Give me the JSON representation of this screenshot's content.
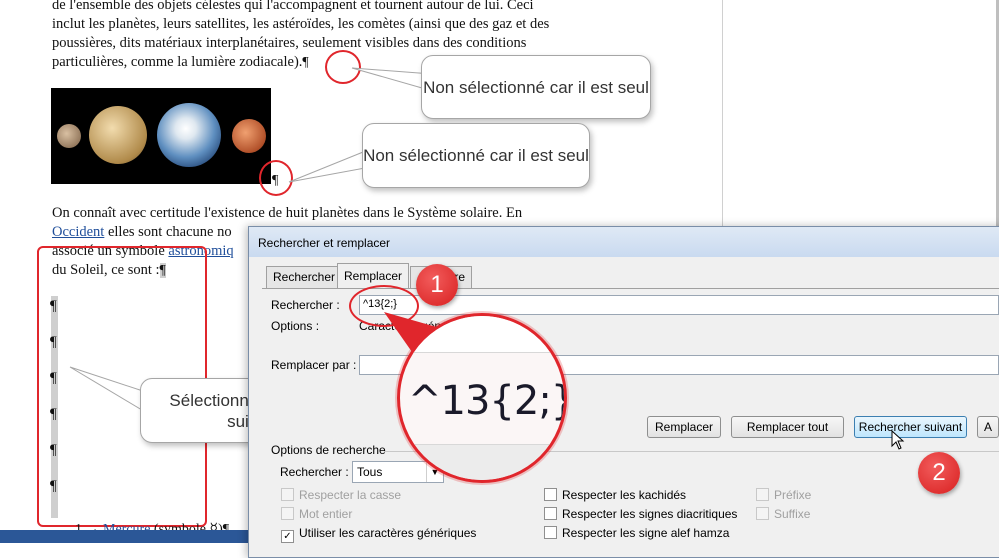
{
  "document": {
    "para1_line1": "de l'ensemble des objets célestes qui l'accompagnent et tournent autour de lui. Ceci",
    "para1_line2": "inclut les planètes, leurs satellites, les astéroïdes, les comètes (ainsi que des gaz et des",
    "para1_line3": "poussières, dits matériaux interplanétaires, seulement visibles dans des conditions",
    "para1_line4": "particulières, comme la lumière zodiacale).",
    "para1_end_pilcrow": "¶",
    "image_pilcrow": "¶",
    "para2_line1": "On connaît avec certitude l'existence de huit planètes dans le Système solaire. En",
    "para2_link1": "Occident",
    "para2_line2_rest": " elles sont chacune no",
    "para2_line3_start": "associé un symbole ",
    "para2_link2": "astronomiq",
    "para2_line4": "du Soleil, ce sont :",
    "para2_end_pilcrow": "¶",
    "pilcrows": [
      "¶",
      "¶",
      "¶",
      "¶",
      "¶",
      "¶"
    ],
    "bottom_item_number": "1 →",
    "bottom_item_link": "Mercure",
    "bottom_item_rest": " (symbole ☿)¶"
  },
  "callouts": {
    "c1": "Non sélectionné car il est seul",
    "c2": "Non sélectionné car il est seul",
    "c3": "Sélectionnés car ils se suivent"
  },
  "dialog": {
    "title": "Rechercher et remplacer",
    "tabs": [
      "Rechercher",
      "Remplacer",
      "Atteindre"
    ],
    "active_tab": "Remplacer",
    "search_label": "Rechercher :",
    "search_value": "^13{2;}",
    "options_label": "Options :",
    "options_value": "Caractères génériques",
    "replace_label": "Remplacer par :",
    "replace_value": "",
    "buttons": {
      "replace": "Remplacer",
      "replace_all": "Remplacer tout",
      "find_next": "Rechercher suivant",
      "cancel_partial": "A"
    },
    "search_options_heading": "Options de recherche",
    "search_dir_label": "Rechercher :",
    "search_dir_value": "Tous",
    "checkboxes": {
      "match_case": "Respecter la casse",
      "whole_word": "Mot entier",
      "wildcards": "Utiliser les caractères génériques",
      "kashida": "Respecter les kachidés",
      "diacritics": "Respecter les signes diacritiques",
      "alef_hamza": "Respecter les signe alef hamza",
      "prefix": "Préfixe",
      "suffix": "Suffixe"
    }
  },
  "magnifier_text": "^13{2;}",
  "badges": {
    "one": "1",
    "two": "2"
  },
  "colors": {
    "annotation_red": "#e0262c",
    "link_blue": "#1f4e9a",
    "dialog_bg": "#f0f0f0"
  }
}
